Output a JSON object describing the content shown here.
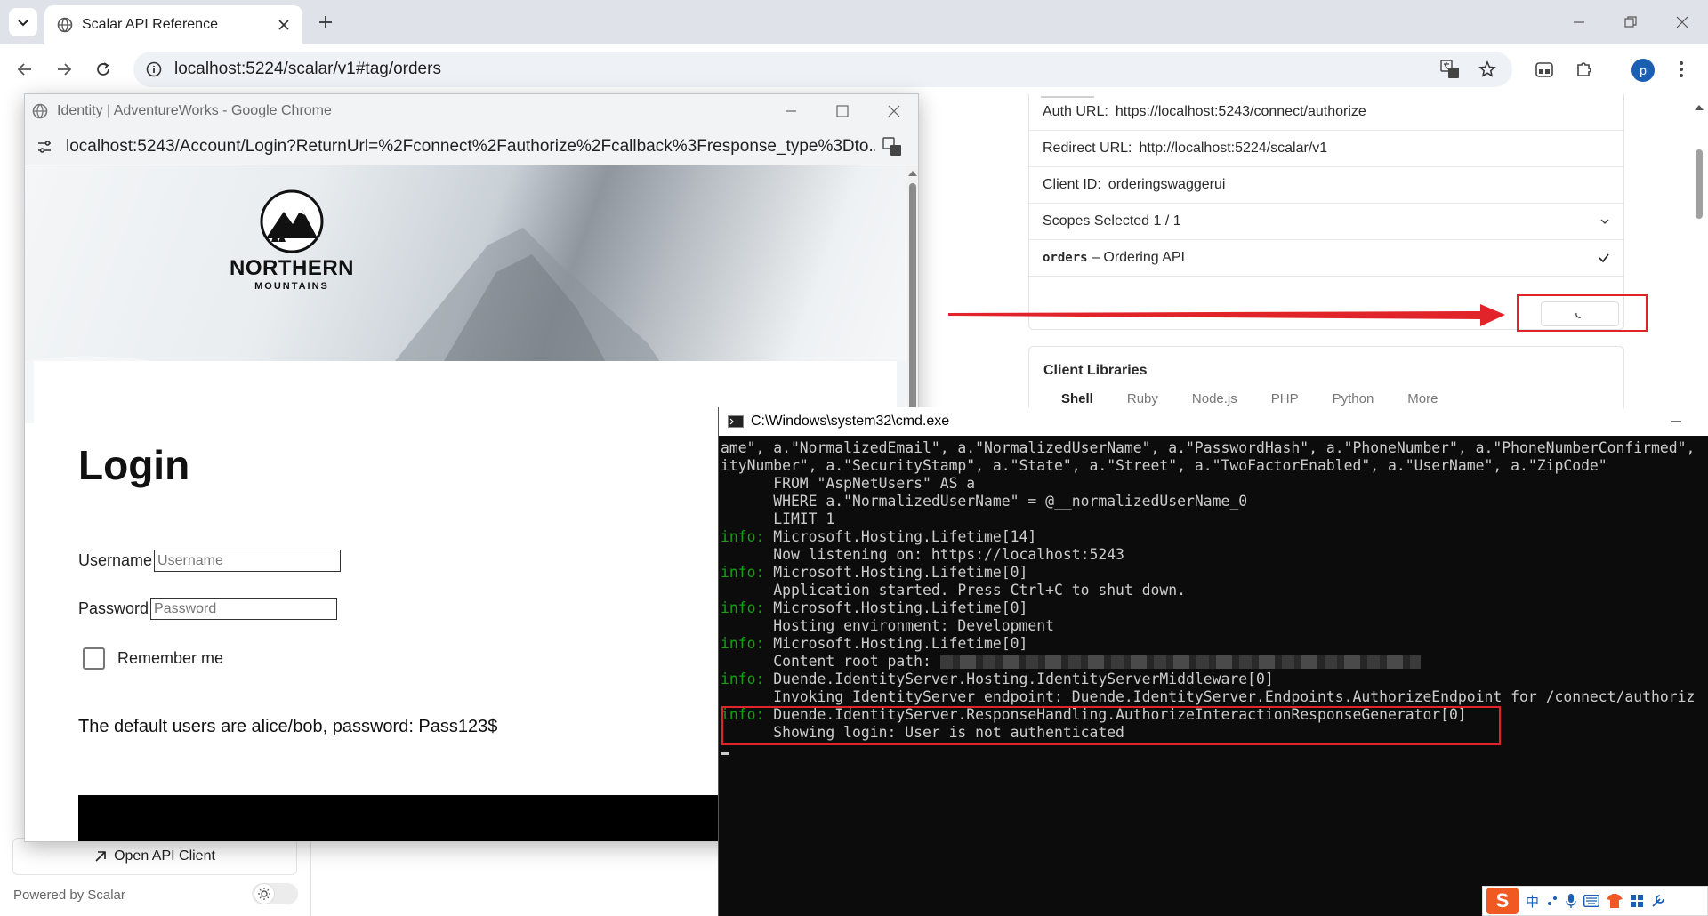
{
  "main_window": {
    "tab_title": "Scalar API Reference",
    "address": "localhost:5224/scalar/v1#tag/orders",
    "profile_initial": "p"
  },
  "scalar": {
    "auth_rows": [
      {
        "label": "Auth URL:",
        "value": "https://localhost:5243/connect/authorize"
      },
      {
        "label": "Redirect URL:",
        "value": "http://localhost:5224/scalar/v1"
      },
      {
        "label": "Client ID:",
        "value": "orderingswaggerui"
      }
    ],
    "scopes_label": "Scopes Selected 1 / 1",
    "scope_name": "orders",
    "scope_desc": "– Ordering API",
    "client_libraries_title": "Client Libraries",
    "lib_tabs": [
      "Shell",
      "Ruby",
      "Node.js",
      "PHP",
      "Python",
      "More"
    ],
    "open_api_client": "Open API Client",
    "powered_by": "Powered by Scalar"
  },
  "popup": {
    "title": "Identity | AdventureWorks - Google Chrome",
    "url": "localhost:5243/Account/Login?ReturnUrl=%2Fconnect%2Fauthorize%2Fcallback%3Fresponse_type%3Dto...",
    "logo_word": "NORTHERN",
    "logo_sub": "MOUNTAINS",
    "login_title": "Login",
    "username_label": "Username",
    "username_placeholder": "Username",
    "password_label": "Password",
    "password_placeholder": "Password",
    "remember_me": "Remember me",
    "default_users_note": "The default users are alice/bob, password: Pass123$"
  },
  "cmd": {
    "title": "C:\\Windows\\system32\\cmd.exe",
    "lines": [
      {
        "type": "text",
        "text": "ame\", a.\"NormalizedEmail\", a.\"NormalizedUserName\", a.\"PasswordHash\", a.\"PhoneNumber\", a.\"PhoneNumberConfirmed\","
      },
      {
        "type": "text",
        "text": "ityNumber\", a.\"SecurityStamp\", a.\"State\", a.\"Street\", a.\"TwoFactorEnabled\", a.\"UserName\", a.\"ZipCode\""
      },
      {
        "type": "text",
        "text": "      FROM \"AspNetUsers\" AS a"
      },
      {
        "type": "text",
        "text": "      WHERE a.\"NormalizedUserName\" = @__normalizedUserName_0"
      },
      {
        "type": "text",
        "text": "      LIMIT 1"
      },
      {
        "type": "info",
        "text": " Microsoft.Hosting.Lifetime[14]"
      },
      {
        "type": "text",
        "text": "      Now listening on: https://localhost:5243"
      },
      {
        "type": "info",
        "text": " Microsoft.Hosting.Lifetime[0]"
      },
      {
        "type": "text",
        "text": "      Application started. Press Ctrl+C to shut down."
      },
      {
        "type": "info",
        "text": " Microsoft.Hosting.Lifetime[0]"
      },
      {
        "type": "text",
        "text": "      Hosting environment: Development"
      },
      {
        "type": "info",
        "text": " Microsoft.Hosting.Lifetime[0]"
      },
      {
        "type": "redacted",
        "text": "      Content root path: "
      },
      {
        "type": "info",
        "text": " Duende.IdentityServer.Hosting.IdentityServerMiddleware[0]"
      },
      {
        "type": "text",
        "text": "      Invoking IdentityServer endpoint: Duende.IdentityServer.Endpoints.AuthorizeEndpoint for /connect/authoriz"
      },
      {
        "type": "info",
        "text": " Duende.IdentityServer.ResponseHandling.AuthorizeInteractionResponseGenerator[0]"
      },
      {
        "type": "text",
        "text": "      Showing login: User is not authenticated"
      }
    ],
    "info_prefix": "info:"
  },
  "ime": {
    "logo": "S",
    "mode": "中"
  },
  "colors": {
    "annotation_red": "#e0242a",
    "cmd_info_green": "#13a10e",
    "profile_blue": "#1a5fb4"
  }
}
